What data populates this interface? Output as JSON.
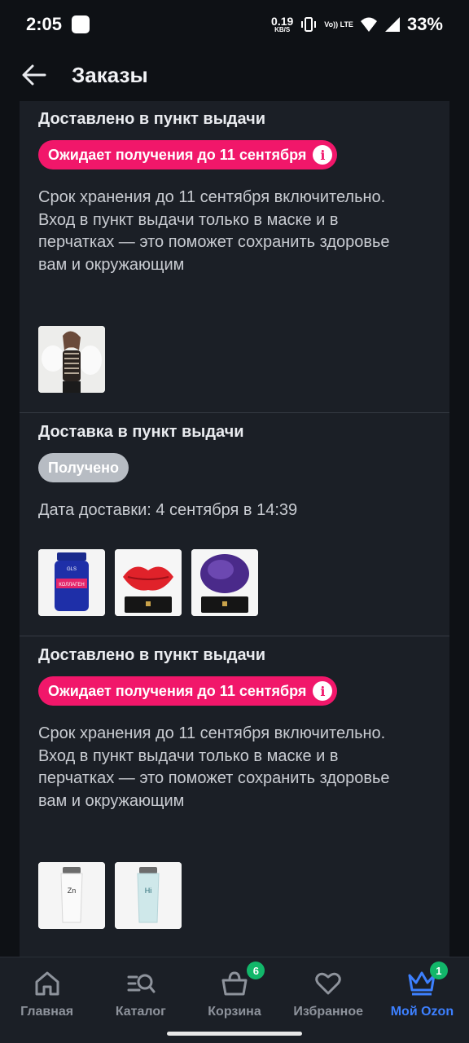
{
  "status_bar": {
    "time": "2:05",
    "net_speed": "0.19",
    "net_unit": "KB/S",
    "volte": "Vo)) LTE",
    "battery": "33%"
  },
  "header": {
    "title": "Заказы"
  },
  "orders": [
    {
      "title": "Доставлено в пункт выдачи",
      "status": "Ожидает получения до 11 сентября",
      "description": "Срок хранения до 11 сентября включительно. Вход в пункт выдачи только в маске и в перчатках — это поможет сохранить здоровье вам и окружающим"
    },
    {
      "title": "Доставка в пункт выдачи",
      "status": "Получено",
      "description": "Дата доставки: 4 сентября в 14:39",
      "thumb_text": [
        "GLS",
        "КОЛЛАГЕН"
      ]
    },
    {
      "title": "Доставлено в пункт выдачи",
      "status": "Ожидает получения до 11 сентября",
      "description": "Срок хранения до 11 сентября включительно. Вход в пункт выдачи только в маске и в перчатках — это поможет сохранить здоровье вам и окружающим",
      "thumb_text": [
        "Zn",
        "Hi"
      ]
    }
  ],
  "bottom_nav": [
    {
      "label": "Главная",
      "icon": "home-icon"
    },
    {
      "label": "Каталог",
      "icon": "catalog-search-icon"
    },
    {
      "label": "Корзина",
      "icon": "cart-icon",
      "badge": "6"
    },
    {
      "label": "Избранное",
      "icon": "heart-icon"
    },
    {
      "label": "Мой Ozon",
      "icon": "crown-icon",
      "badge": "1",
      "active": true
    }
  ],
  "colors": {
    "accent_pink": "#f1176a",
    "active_blue": "#3d80ff",
    "badge_green": "#12b76a",
    "card_bg": "#1b1f26",
    "page_bg": "#0e1115"
  }
}
